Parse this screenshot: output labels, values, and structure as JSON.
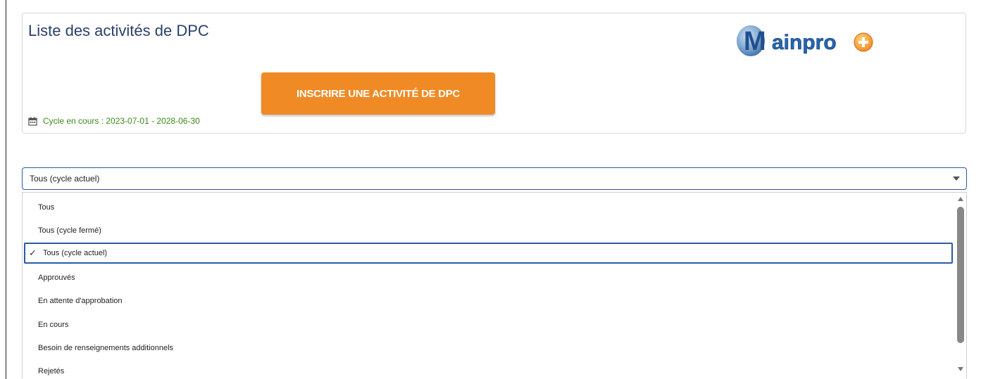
{
  "header": {
    "title": "Liste des activités de DPC",
    "register_button_label": "INSCRIRE UNE ACTIVITÉ DE DPC",
    "cycle_text": "Cycle en cours : 2023-07-01 - 2028-06-30",
    "logo_text": "Mainpro"
  },
  "filter": {
    "selected_value": "Tous (cycle actuel)",
    "options": [
      {
        "label": "Tous"
      },
      {
        "label": "Tous (cycle fermé)"
      },
      {
        "label": "Tous (cycle actuel)",
        "selected": true
      },
      {
        "label": "Approuvés"
      },
      {
        "label": "En attente d'approbation"
      },
      {
        "label": "En cours"
      },
      {
        "label": "Besoin de renseignements additionnels"
      },
      {
        "label": "Rejetés"
      }
    ]
  },
  "colors": {
    "title": "#2b3f6b",
    "button_bg": "#f08a24",
    "cycle_text": "#3b8a1a",
    "select_border": "#2b5aa8"
  },
  "icons": {
    "cycle": "calendar-icon",
    "select": "caret-down-icon",
    "selected_option": "checkmark-icon"
  }
}
